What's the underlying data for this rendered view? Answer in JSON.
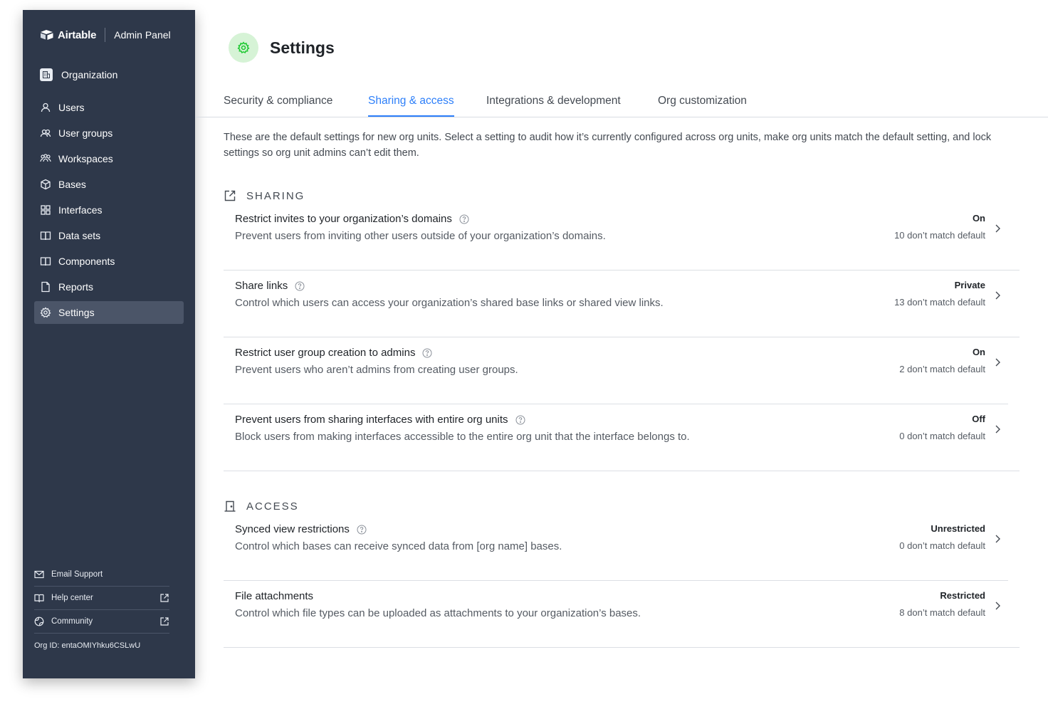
{
  "sidebar": {
    "brand": "Airtable",
    "panel_label": "Admin Panel",
    "org_label": "Organization",
    "items": [
      {
        "label": "Users",
        "icon": "user-icon"
      },
      {
        "label": "User groups",
        "icon": "user-group-icon"
      },
      {
        "label": "Workspaces",
        "icon": "workspaces-icon"
      },
      {
        "label": "Bases",
        "icon": "cube-icon"
      },
      {
        "label": "Interfaces",
        "icon": "grid-icon"
      },
      {
        "label": "Data sets",
        "icon": "book-icon"
      },
      {
        "label": "Components",
        "icon": "book-icon"
      },
      {
        "label": "Reports",
        "icon": "file-icon"
      },
      {
        "label": "Settings",
        "icon": "gear-icon",
        "active": true
      }
    ],
    "footer": {
      "email_support": "Email Support",
      "help_center": "Help center",
      "community": "Community",
      "org_id": "Org ID: entaOMIYhku6CSLwU"
    }
  },
  "page": {
    "title": "Settings",
    "tabs": [
      {
        "label": "Security & compliance",
        "active": false
      },
      {
        "label": "Sharing & access",
        "active": true
      },
      {
        "label": "Integrations & development",
        "active": false
      },
      {
        "label": "Org customization",
        "active": false
      }
    ],
    "intro": "These are the default settings for new org units. Select a setting to audit how it’s currently configured across org units, make org units match the default setting, and lock settings so org unit admins can’t edit them."
  },
  "sections": {
    "sharing": {
      "title": "SHARING",
      "rows": [
        {
          "title": "Restrict invites to your organization’s domains",
          "desc": "Prevent users from inviting other users outside of your organization’s domains.",
          "status": "On",
          "mismatch": "10 don’t match default"
        },
        {
          "title": "Share links",
          "desc": "Control which users can access your organization’s shared base links or shared view links.",
          "status": "Private",
          "mismatch": "13 don’t match default"
        },
        {
          "title": "Restrict user group creation to admins",
          "desc": "Prevent users who aren’t admins from creating user groups.",
          "status": "On",
          "mismatch": "2 don’t match default"
        },
        {
          "title": "Prevent users from sharing interfaces with entire org units",
          "desc": "Block users from making interfaces accessible to the entire org unit that the interface belongs to.",
          "status": "Off",
          "mismatch": "0 don’t match default"
        }
      ]
    },
    "access": {
      "title": "ACCESS",
      "rows": [
        {
          "title": "Synced view restrictions",
          "desc": "Control which bases can receive synced data from [org name] bases.",
          "status": "Unrestricted",
          "mismatch": "0 don’t match default"
        },
        {
          "title": "File attachments",
          "desc": "Control which file types can be uploaded as attachments to your organization’s bases.",
          "status": "Restricted",
          "mismatch": "8 don’t match default"
        }
      ]
    }
  },
  "colors": {
    "sidebar_bg": "#2e384a",
    "active_nav": "#4b5568",
    "accent": "#2d7ff9",
    "settings_icon_bg": "#d6f3d6",
    "settings_icon_fg": "#20c933"
  }
}
